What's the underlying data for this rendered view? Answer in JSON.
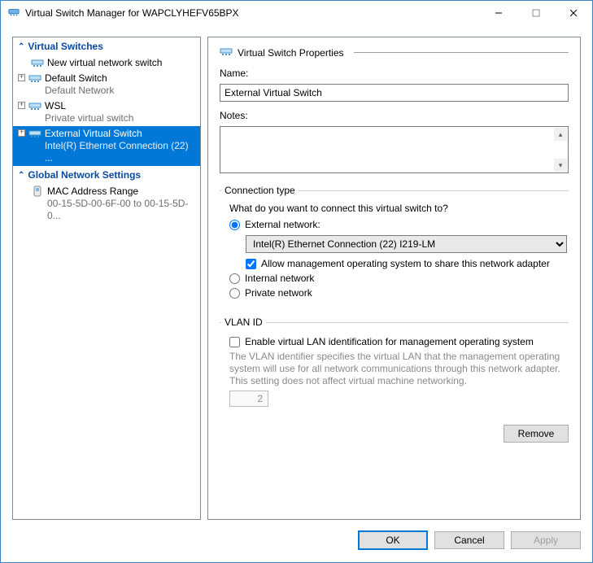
{
  "window": {
    "title": "Virtual Switch Manager for WAPCLYHEFV65BPX"
  },
  "tree": {
    "header_switches": "Virtual Switches",
    "new_switch": "New virtual network switch",
    "items": [
      {
        "label": "Default Switch",
        "sub": "Default Network"
      },
      {
        "label": "WSL",
        "sub": "Private virtual switch"
      },
      {
        "label": "External Virtual Switch",
        "sub": "Intel(R) Ethernet Connection (22) ..."
      }
    ],
    "header_global": "Global Network Settings",
    "mac_label": "MAC Address Range",
    "mac_sub": "00-15-5D-00-6F-00 to 00-15-5D-0..."
  },
  "props": {
    "header": "Virtual Switch Properties",
    "name_label": "Name:",
    "name_value": "External Virtual Switch",
    "notes_label": "Notes:",
    "conn": {
      "legend": "Connection type",
      "question": "What do you want to connect this virtual switch to?",
      "external": "External network:",
      "adapter": "Intel(R) Ethernet Connection (22) I219-LM",
      "allow_mgmt": "Allow management operating system to share this network adapter",
      "internal": "Internal network",
      "private": "Private network"
    },
    "vlan": {
      "legend": "VLAN ID",
      "enable": "Enable virtual LAN identification for management operating system",
      "desc": "The VLAN identifier specifies the virtual LAN that the management operating system will use for all network communications through this network adapter. This setting does not affect virtual machine networking.",
      "id": "2"
    },
    "remove": "Remove"
  },
  "footer": {
    "ok": "OK",
    "cancel": "Cancel",
    "apply": "Apply"
  }
}
